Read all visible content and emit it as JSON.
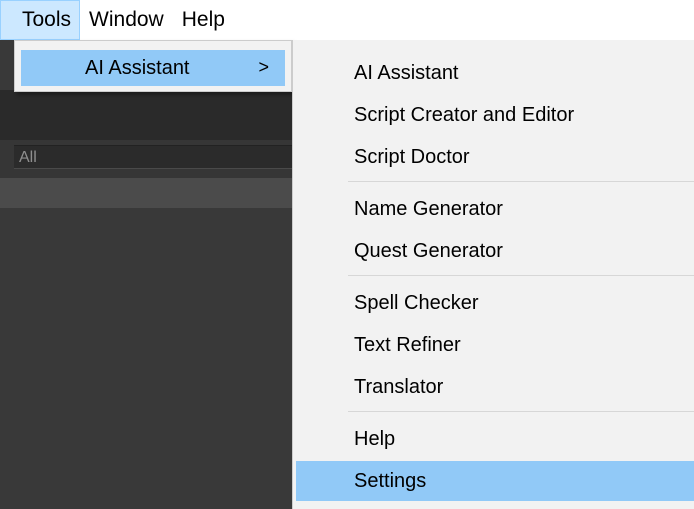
{
  "menubar": {
    "items": [
      {
        "label": "Tools"
      },
      {
        "label": "Window"
      },
      {
        "label": "Help"
      }
    ]
  },
  "editor": {
    "filter_value": "All"
  },
  "tools_menu": {
    "items": [
      {
        "label": "AI Assistant",
        "arrow": ">"
      }
    ]
  },
  "submenu": {
    "items": [
      {
        "label": "AI Assistant"
      },
      {
        "label": "Script Creator and Editor"
      },
      {
        "label": "Script Doctor"
      },
      {
        "label": "Name Generator"
      },
      {
        "label": "Quest Generator"
      },
      {
        "label": "Spell Checker"
      },
      {
        "label": "Text Refiner"
      },
      {
        "label": "Translator"
      },
      {
        "label": "Help"
      },
      {
        "label": "Settings"
      }
    ],
    "highlighted": "Settings"
  },
  "colors": {
    "highlight": "#91c9f7",
    "menu_background": "#f2f2f2",
    "editor_background": "#393939"
  }
}
